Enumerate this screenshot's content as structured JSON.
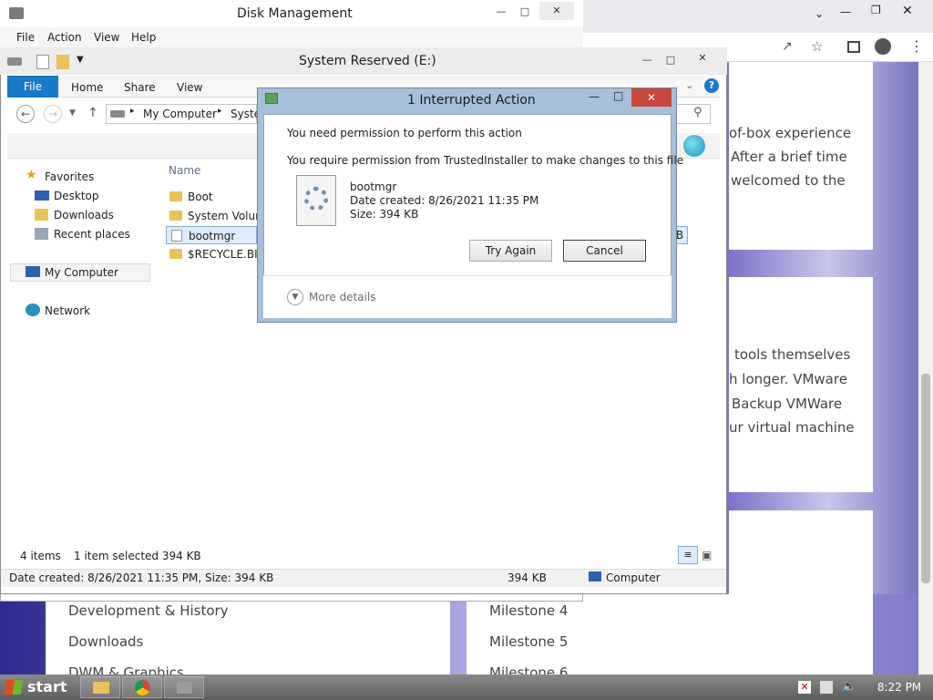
{
  "browser": {
    "card1_lines": [
      "of-box experience",
      "After a brief time",
      "welcomed to the"
    ],
    "card2_lines": [
      "tools themselves",
      "h longer. VMware",
      "Backup  VMWare",
      "ur virtual machine"
    ],
    "bottom_left": [
      "Development & History",
      "Downloads",
      "DWM & Graphics"
    ],
    "bottom_right": [
      "Milestone 4",
      "Milestone 5",
      "Milestone 6"
    ]
  },
  "disk_management": {
    "title": "Disk Management",
    "menu": [
      "File",
      "Action",
      "View",
      "Help"
    ]
  },
  "explorer": {
    "title": "System Reserved (E:)",
    "tabs": {
      "file": "File",
      "home": "Home",
      "share": "Share",
      "view": "View"
    },
    "breadcrumb": {
      "root": "My Computer",
      "current": "Syste"
    },
    "nav": {
      "favorites": "Favorites",
      "desktop": "Desktop",
      "downloads": "Downloads",
      "recent": "Recent places",
      "computer": "My Computer",
      "network": "Network"
    },
    "column_name": "Name",
    "files": [
      "Boot",
      "System Volum",
      "bootmgr",
      "$RECYCLE.BIN"
    ],
    "status": {
      "count": "4 items",
      "selected": "1 item selected  394 KB"
    },
    "details": {
      "info": "Date created: 8/26/2021 11:35 PM, Size: 394 KB",
      "size": "394 KB",
      "location": "Computer"
    },
    "fragment": "B"
  },
  "dialog": {
    "title": "1 Interrupted Action",
    "heading": "You need permission to perform this action",
    "message": "You require permission from TrustedInstaller to make changes to this file",
    "file_name": "bootmgr",
    "file_date": "Date created: 8/26/2021 11:35 PM",
    "file_size": "Size: 394 KB",
    "try_again": "Try Again",
    "cancel": "Cancel",
    "more_details": "More details"
  },
  "taskbar": {
    "start": "start",
    "time": "8:22 PM"
  },
  "colors": {
    "accent": "#1979ca",
    "close": "#c7473a"
  }
}
